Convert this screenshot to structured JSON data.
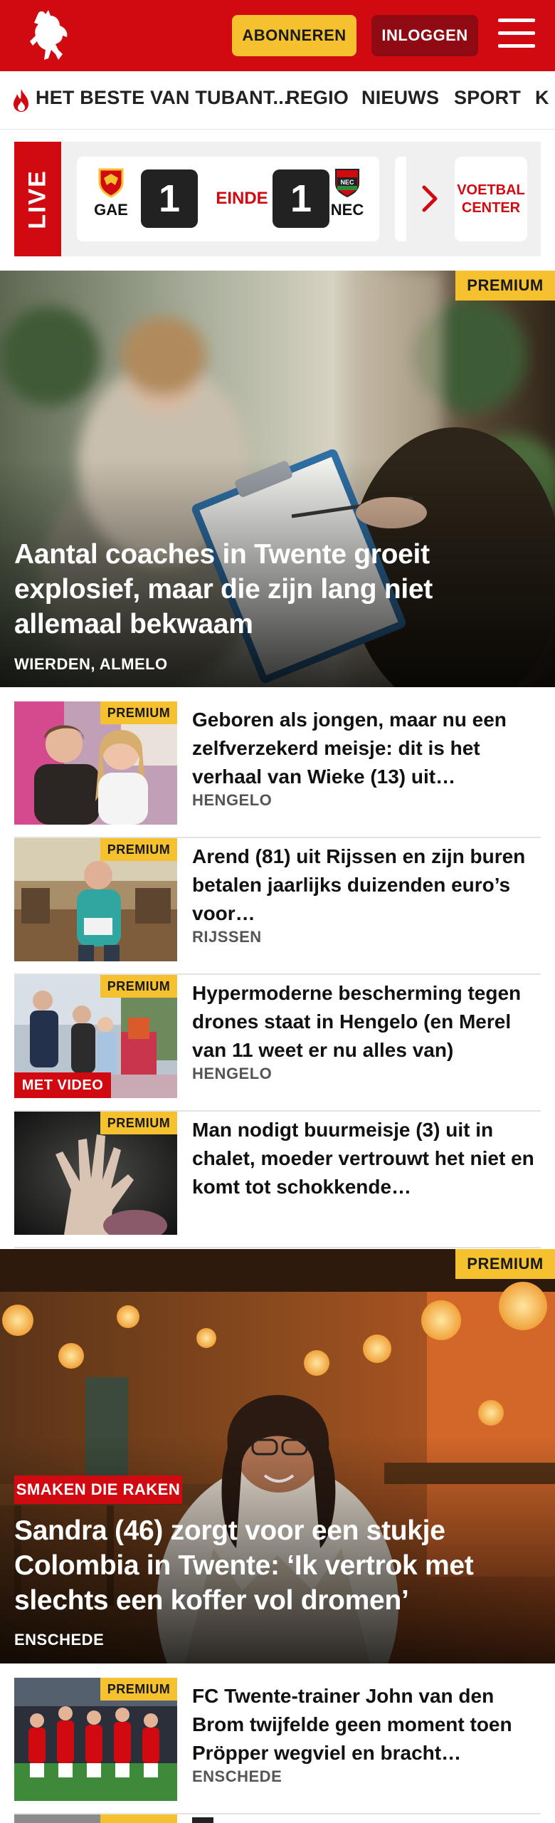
{
  "header": {
    "subscribe_label": "ABONNEREN",
    "login_label": "INLOGGEN"
  },
  "nav": {
    "items": [
      "HET BESTE VAN TUBANT...",
      "REGIO",
      "NIEUWS",
      "SPORT",
      "K"
    ]
  },
  "live": {
    "tag": "LIVE",
    "home": "GAE",
    "home_score": "1",
    "status": "EINDE",
    "away_score": "1",
    "away": "NEC",
    "voetbal_center": "VOETBAL CENTER"
  },
  "hero1": {
    "badge": "PREMIUM",
    "title": "Aantal coaches in Twente groeit explosief, maar die zijn lang niet allemaal bekwaam",
    "location": "WIERDEN, ALMELO"
  },
  "articles1": [
    {
      "badge": "PREMIUM",
      "title": "Geboren als jongen, maar nu een zelfverzekerd meisje: dit is het verhaal van Wieke (13) uit…",
      "location": "HENGELO",
      "tag": ""
    },
    {
      "badge": "PREMIUM",
      "title": "Arend (81) uit Rijssen en zijn buren betalen jaarlijks duizenden euro’s voor…",
      "location": "RIJSSEN",
      "tag": ""
    },
    {
      "badge": "PREMIUM",
      "title": "Hypermoderne bescherming tegen drones staat in Hengelo (en Merel van 11 weet er nu alles van)",
      "location": "HENGELO",
      "tag": "MET VIDEO"
    },
    {
      "badge": "PREMIUM",
      "title": "Man nodigt buurmeisje (3) uit in chalet, moeder vertrouwt het niet en komt tot schokkende…",
      "location": "",
      "tag": ""
    }
  ],
  "hero2": {
    "badge": "PREMIUM",
    "tag": "SMAKEN DIE RAKEN",
    "title": "Sandra (46) zorgt voor een stukje Colombia in Twente: ‘Ik vertrok met slechts een koffer vol dromen’",
    "location": "ENSCHEDE"
  },
  "articles2": [
    {
      "badge": "PREMIUM",
      "title": "FC Twente-trainer John van den Brom twijfelde geen moment toen Pröpper wegviel en bracht…",
      "location": "ENSCHEDE"
    }
  ],
  "colors": {
    "brand_red": "#d10a11",
    "premium_yellow": "#f5c12e",
    "dark_red": "#8f0a12"
  },
  "icons": [
    "horse-logo-icon",
    "menu-icon",
    "flame-icon",
    "go-ahead-eagles-crest-icon",
    "nec-crest-icon",
    "chevron-right-icon"
  ]
}
